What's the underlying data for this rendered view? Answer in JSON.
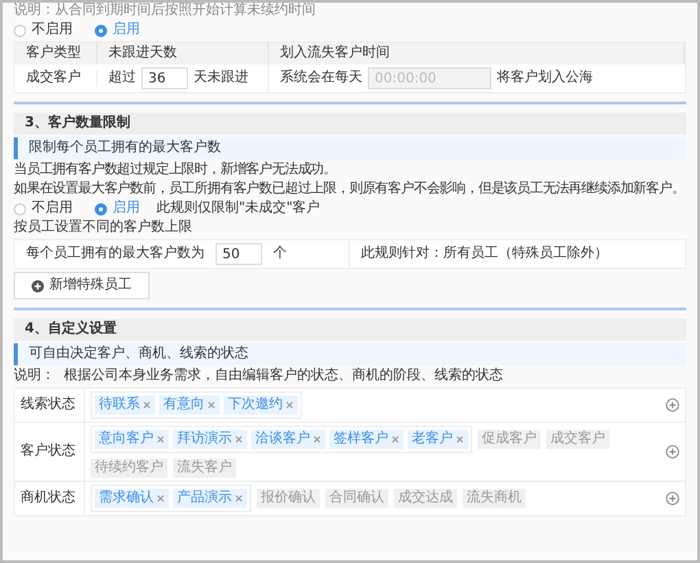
{
  "top_note": "说明：从合同到期时间后按照开始计算未续约时间",
  "section2": {
    "radios": [
      {
        "label": "不启用",
        "selected": false
      },
      {
        "label": "启用",
        "selected": true
      }
    ],
    "table": {
      "columns": [
        "客户类型",
        "未跟进天数",
        "划入流失客户时间"
      ],
      "row": {
        "type": "成交客户",
        "days_prefix": "超过",
        "days": "36",
        "days_suffix": "天未跟进",
        "time_prefix": "系统会在每天",
        "time_placeholder": "00:00:00",
        "time_suffix": "将客户划入公海"
      }
    }
  },
  "section3": {
    "title": "3、客户数量限制",
    "info": "限制每个员工拥有的最大客户数",
    "lines": [
      "当员工拥有客户数超过规定上限时，新增客户无法成功。",
      "如果在设置最大客户数前，员工所拥有客户数已超过上限，则原有客户不会影响，但是该员工无法再继续添加新客户。"
    ],
    "radios": [
      {
        "label": "不启用",
        "selected": false
      },
      {
        "label": "启用",
        "selected": true
      }
    ],
    "radio_note": "此规则仅限制\"未成交\"客户",
    "sub_label": "按员工设置不同的客户数上限",
    "max_label": "每个员工拥有的最大客户数为",
    "max_value": "50",
    "max_unit": "个",
    "scope": "此规则针对：所有员工（特殊员工除外）",
    "add_button": "新增特殊员工"
  },
  "section4": {
    "title": "4、自定义设置",
    "info": "可自由决定客户、商机、线索的状态",
    "description": "说明：  根据公司本身业务需求，自由编辑客户的状态、商机的阶段、线索的状态",
    "rows": [
      {
        "label": "线索状态",
        "tags": [
          {
            "text": "待联系",
            "selected": true
          },
          {
            "text": "有意向",
            "selected": true
          },
          {
            "text": "下次邀约",
            "selected": true
          }
        ]
      },
      {
        "label": "客户状态",
        "tags": [
          {
            "text": "意向客户",
            "selected": true
          },
          {
            "text": "拜访演示",
            "selected": true
          },
          {
            "text": "洽谈客户",
            "selected": true
          },
          {
            "text": "签样客户",
            "selected": true
          },
          {
            "text": "老客户",
            "selected": true
          },
          {
            "text": "促成客户",
            "selected": false
          },
          {
            "text": "成交客户",
            "selected": false
          },
          {
            "text": "待续约客户",
            "selected": false
          },
          {
            "text": "流失客户",
            "selected": false
          }
        ]
      },
      {
        "label": "商机状态",
        "tags": [
          {
            "text": "需求确认",
            "selected": true
          },
          {
            "text": "产品演示",
            "selected": true
          },
          {
            "text": "报价确认",
            "selected": false
          },
          {
            "text": "合同确认",
            "selected": false
          },
          {
            "text": "成交达成",
            "selected": false
          },
          {
            "text": "流失商机",
            "selected": false
          }
        ]
      }
    ]
  }
}
